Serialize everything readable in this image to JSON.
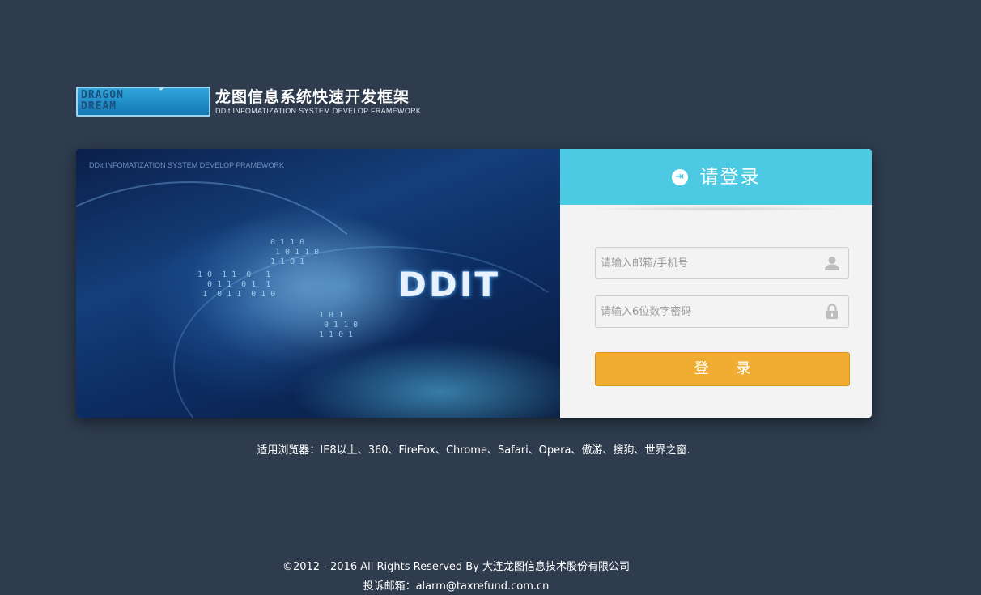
{
  "header": {
    "logo_mark_line1": "DRAGON",
    "logo_mark_line2": "DREAM",
    "title_cn": "龙图信息系统快速开发框架",
    "title_en": "DDit INFOMATIZATION SYSTEM DEVELOP FRAMEWORK"
  },
  "banner": {
    "tagline": "DDit INFOMATIZATION SYSTEM DEVELOP FRAMEWORK",
    "title": "DDIT"
  },
  "login": {
    "title": "请登录",
    "icon": "login-arrow-icon",
    "account_placeholder": "请输入邮箱/手机号",
    "account_value": "",
    "account_icon": "user-icon",
    "password_placeholder": "请输入6位数字密码",
    "password_value": "",
    "password_icon": "lock-icon",
    "submit_label": "登 录"
  },
  "footer": {
    "browsers": "适用浏览器：IE8以上、360、FireFox、Chrome、Safari、Opera、傲游、搜狗、世界之窗.",
    "copyright": "©2012 - 2016 All Rights Reserved By 大连龙图信息技术股份有限公司",
    "complaint": "投诉邮箱：alarm@taxrefund.com.cn"
  },
  "colors": {
    "background": "#2e3c4e",
    "login_header": "#4ccae4",
    "login_button": "#f0ad32"
  }
}
